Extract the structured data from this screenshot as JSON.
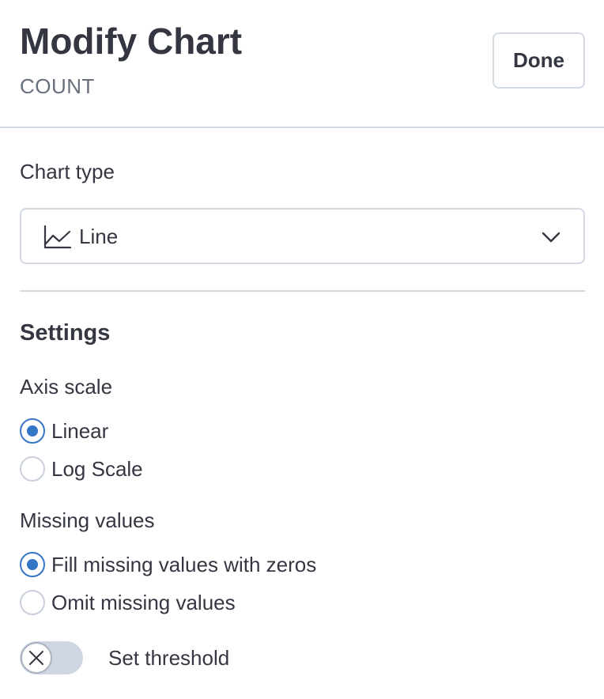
{
  "header": {
    "title": "Modify Chart",
    "subtitle": "COUNT",
    "done_label": "Done"
  },
  "chart_type": {
    "label": "Chart type",
    "selected": "Line",
    "icon": "line-chart-icon"
  },
  "settings": {
    "title": "Settings",
    "axis_scale": {
      "label": "Axis scale",
      "options": [
        {
          "label": "Linear",
          "checked": true
        },
        {
          "label": "Log Scale",
          "checked": false
        }
      ]
    },
    "missing_values": {
      "label": "Missing values",
      "options": [
        {
          "label": "Fill missing values with zeros",
          "checked": true
        },
        {
          "label": "Omit missing values",
          "checked": false
        }
      ]
    },
    "threshold": {
      "label": "Set threshold",
      "enabled": false
    }
  },
  "colors": {
    "accent": "#3575c6",
    "text": "#343741",
    "subdued": "#69707d",
    "border": "#d3dae6"
  }
}
